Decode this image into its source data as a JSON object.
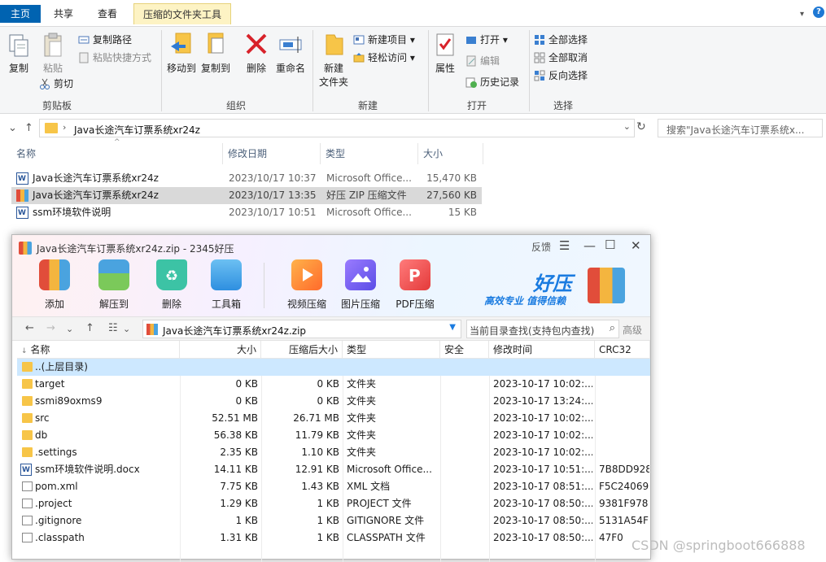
{
  "ribbon_tabs": {
    "home": "主页",
    "share": "共享",
    "view": "查看",
    "context": "压缩的文件夹工具"
  },
  "ribbon": {
    "clipboard": {
      "copy": "复制",
      "paste": "粘贴",
      "copy_path": "复制路径",
      "paste_shortcut": "粘贴快捷方式",
      "cut": "剪切",
      "label": "剪贴板"
    },
    "organize": {
      "move_to": "移动到",
      "copy_to": "复制到",
      "delete": "删除",
      "rename": "重命名",
      "label": "组织"
    },
    "new": {
      "new_folder_line1": "新建",
      "new_folder_line2": "文件夹",
      "new_item": "新建项目",
      "easy_access": "轻松访问",
      "label": "新建"
    },
    "open": {
      "properties": "属性",
      "open": "打开",
      "edit": "编辑",
      "history": "历史记录",
      "label": "打开"
    },
    "select": {
      "select_all": "全部选择",
      "select_none": "全部取消",
      "invert": "反向选择",
      "label": "选择"
    }
  },
  "address": {
    "path": "Java长途汽车订票系统xr24z",
    "search_placeholder": "搜索\"Java长途汽车订票系统x..."
  },
  "explorer_list": {
    "columns": [
      "名称",
      "修改日期",
      "类型",
      "大小"
    ],
    "rows": [
      {
        "name": "Java长途汽车订票系统xr24z",
        "date": "2023/10/17 10:37",
        "type": "Microsoft Office...",
        "size": "15,470 KB",
        "icon": "word-doc-icon"
      },
      {
        "name": "Java长途汽车订票系统xr24z",
        "date": "2023/10/17 13:35",
        "type": "好压 ZIP 压缩文件",
        "size": "27,560 KB",
        "icon": "zip-archive-icon"
      },
      {
        "name": "ssm环境软件说明",
        "date": "2023/10/17 10:51",
        "type": "Microsoft Office...",
        "size": "15 KB",
        "icon": "word-doc-icon"
      }
    ]
  },
  "haozip": {
    "title": "Java长途汽车订票系统xr24z.zip - 2345好压",
    "feedback": "反馈",
    "toolbar": {
      "add": "添加",
      "extract": "解压到",
      "delete": "删除",
      "toolbox": "工具箱",
      "video": "视频压缩",
      "image": "图片压缩",
      "pdf": "PDF压缩"
    },
    "brand": "好压",
    "slogan": "高效专业  值得信赖",
    "path": "Java长途汽车订票系统xr24z.zip",
    "search_placeholder": "当前目录查找(支持包内查找)",
    "advanced": "高级",
    "columns": [
      "名称",
      "大小",
      "压缩后大小",
      "类型",
      "安全",
      "修改时间",
      "CRC32"
    ],
    "rows": [
      {
        "name": "..(上层目录)",
        "size": "",
        "packed": "",
        "type": "",
        "mtime": "",
        "crc": "",
        "kind": "folder"
      },
      {
        "name": "target",
        "size": "0 KB",
        "packed": "0 KB",
        "type": "文件夹",
        "mtime": "2023-10-17 10:02:...",
        "crc": "",
        "kind": "folder"
      },
      {
        "name": "ssmi89oxms9",
        "size": "0 KB",
        "packed": "0 KB",
        "type": "文件夹",
        "mtime": "2023-10-17 13:24:...",
        "crc": "",
        "kind": "folder"
      },
      {
        "name": "src",
        "size": "52.51 MB",
        "packed": "26.71 MB",
        "type": "文件夹",
        "mtime": "2023-10-17 10:02:...",
        "crc": "",
        "kind": "folder"
      },
      {
        "name": "db",
        "size": "56.38 KB",
        "packed": "11.79 KB",
        "type": "文件夹",
        "mtime": "2023-10-17 10:02:...",
        "crc": "",
        "kind": "folder"
      },
      {
        "name": ".settings",
        "size": "2.35 KB",
        "packed": "1.10 KB",
        "type": "文件夹",
        "mtime": "2023-10-17 10:02:...",
        "crc": "",
        "kind": "folder"
      },
      {
        "name": "ssm环境软件说明.docx",
        "size": "14.11 KB",
        "packed": "12.91 KB",
        "type": "Microsoft Office...",
        "mtime": "2023-10-17 10:51:...",
        "crc": "7B8DD928",
        "kind": "doc"
      },
      {
        "name": "pom.xml",
        "size": "7.75 KB",
        "packed": "1.43 KB",
        "type": "XML 文档",
        "mtime": "2023-10-17 08:51:...",
        "crc": "F5C24069",
        "kind": "file"
      },
      {
        "name": ".project",
        "size": "1.29 KB",
        "packed": "1 KB",
        "type": "PROJECT 文件",
        "mtime": "2023-10-17 08:50:...",
        "crc": "9381F978",
        "kind": "file"
      },
      {
        "name": ".gitignore",
        "size": "1 KB",
        "packed": "1 KB",
        "type": "GITIGNORE 文件",
        "mtime": "2023-10-17 08:50:...",
        "crc": "5131A54F",
        "kind": "file"
      },
      {
        "name": ".classpath",
        "size": "1.31 KB",
        "packed": "1 KB",
        "type": "CLASSPATH 文件",
        "mtime": "2023-10-17 08:50:...",
        "crc": "47F0",
        "kind": "file"
      }
    ]
  },
  "watermark": "CSDN @springboot666888",
  "colors": {
    "accent": "#0063b1",
    "context_tab": "#fdf3c4",
    "selection": "#cde8ff",
    "brand_blue": "#1a7be0"
  }
}
